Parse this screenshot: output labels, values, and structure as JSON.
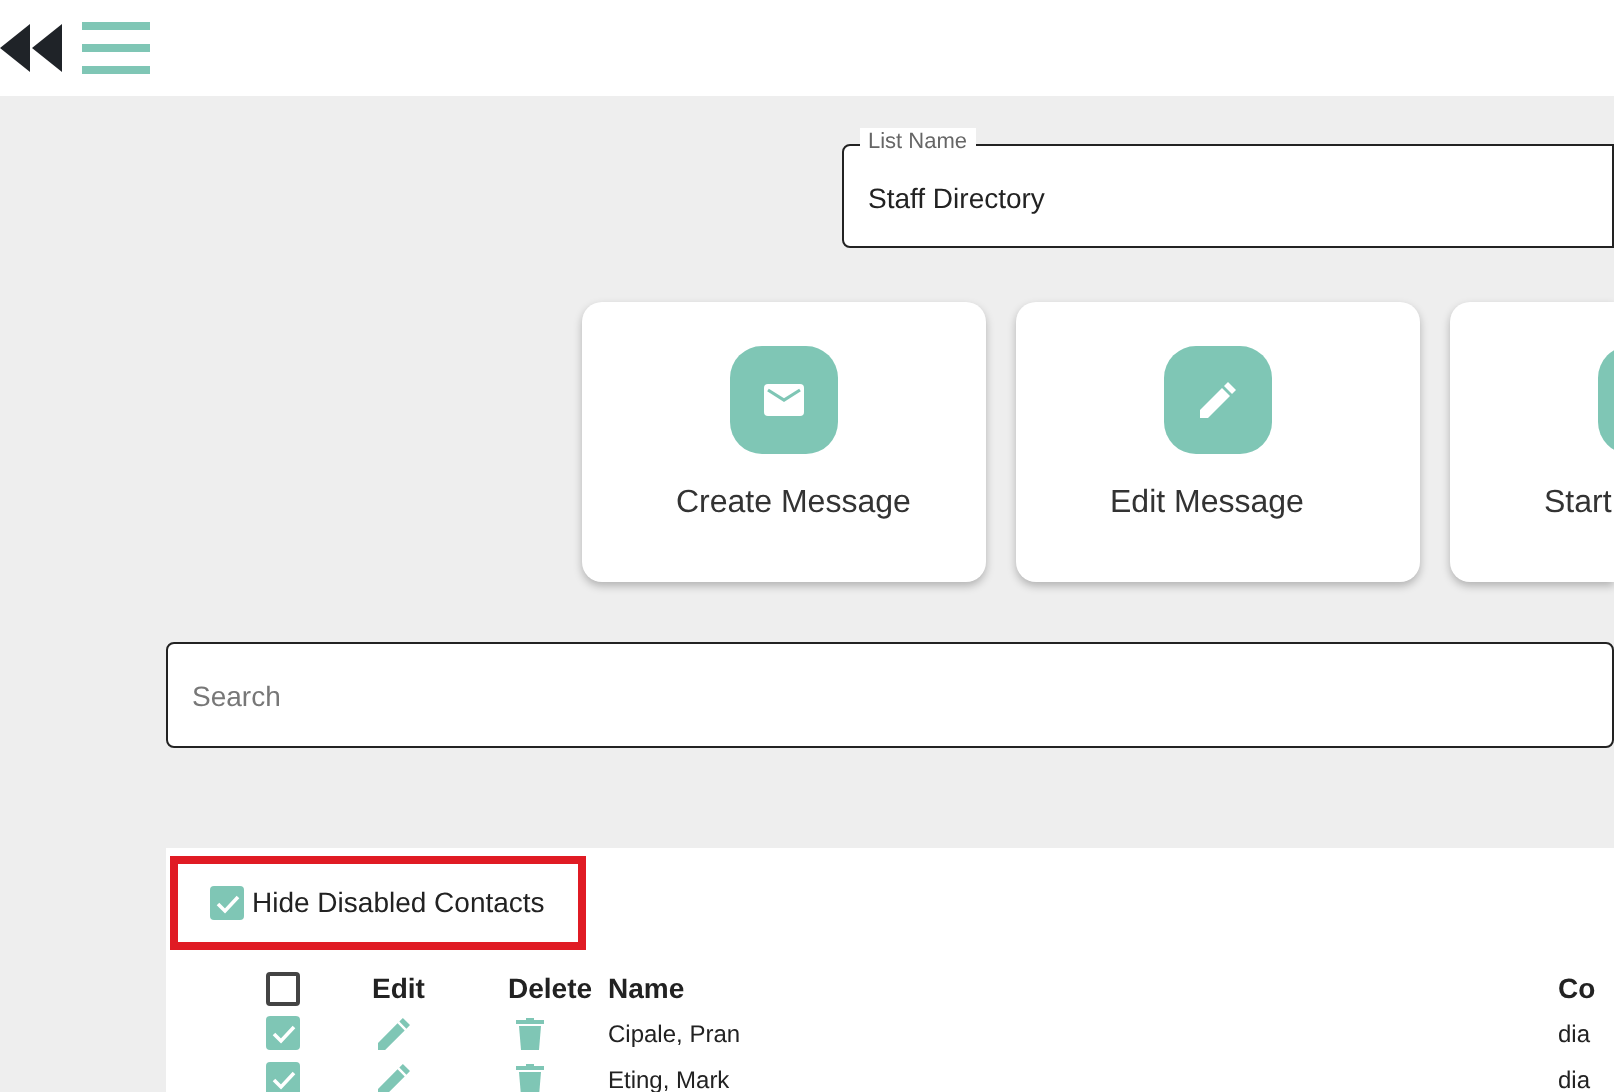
{
  "list_name": {
    "label": "List Name",
    "value": "Staff Directory"
  },
  "actions": [
    {
      "kind": "mail",
      "label": "Create Message"
    },
    {
      "kind": "edit",
      "label": "Edit Message"
    },
    {
      "kind": "other",
      "label": "Start"
    }
  ],
  "search": {
    "placeholder": "Search"
  },
  "hide_disabled": {
    "label": "Hide Disabled Contacts",
    "checked": true
  },
  "table": {
    "select_all": {
      "checked": false
    },
    "columns": [
      "Edit",
      "Delete",
      "Name",
      "Co"
    ],
    "rows": [
      {
        "checked": true,
        "name": "Cipale, Pran",
        "column_4": "dia"
      },
      {
        "checked": true,
        "name": "Eting, Mark",
        "column_4": "dia"
      }
    ]
  }
}
